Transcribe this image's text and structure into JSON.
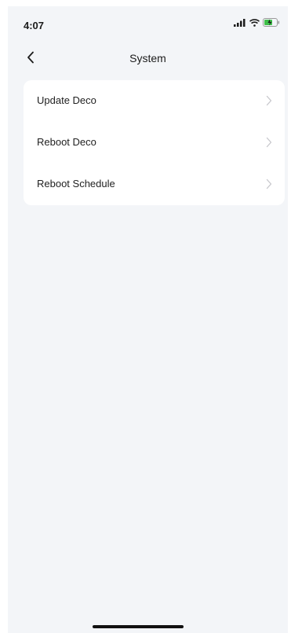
{
  "status_bar": {
    "time": "4:07",
    "signal_icon": "signal-icon",
    "wifi_icon": "wifi-icon",
    "battery_icon": "battery-charging-icon",
    "battery_color": "#3fbf4a"
  },
  "nav": {
    "back_icon": "chevron-left-icon",
    "title": "System"
  },
  "menu": {
    "items": [
      {
        "label": "Update Deco"
      },
      {
        "label": "Reboot Deco"
      },
      {
        "label": "Reboot Schedule"
      }
    ],
    "chevron_icon": "chevron-right-icon"
  },
  "colors": {
    "background": "#f3f5f8",
    "card": "#ffffff",
    "text": "#1f1f1f",
    "chevron": "#c7c7cc"
  }
}
